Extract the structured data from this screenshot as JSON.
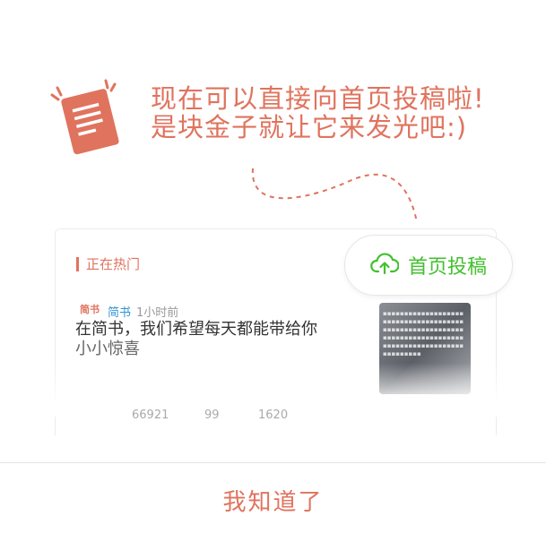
{
  "headline": {
    "line1": "现在可以直接向首页投稿啦!",
    "line2": "是块金子就让它来发光吧:)"
  },
  "card": {
    "section_title": "正在热门",
    "submit_button": "首页投稿",
    "article": {
      "logo_text": "简书",
      "author": "简书",
      "time": "1小时前",
      "title_line1": "在简书，我们希望每天都能带给你",
      "title_line2": "小小惊喜",
      "stats": [
        "66921",
        "99",
        "1620"
      ]
    }
  },
  "confirm_button": "我知道了",
  "colors": {
    "accent": "#e0735e",
    "submit_green": "#42c02e",
    "author_blue": "#3194d0"
  },
  "icons": {
    "document": "document-icon",
    "upload": "cloud-upload-icon"
  }
}
